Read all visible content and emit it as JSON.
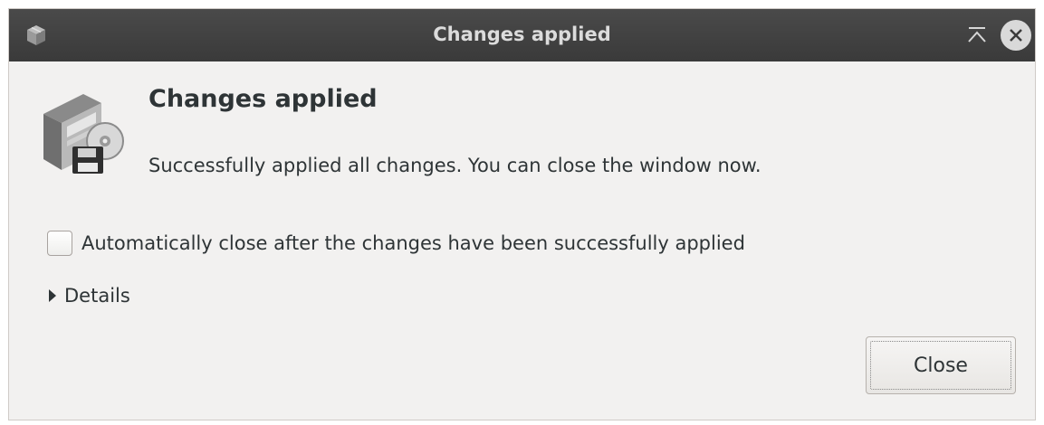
{
  "window": {
    "title": "Changes applied"
  },
  "titlebar": {
    "app_icon": "package-manager-icon",
    "maximize_icon": "maximize-icon",
    "close_icon": "close-icon"
  },
  "dialog": {
    "icon": "software-package-disk-icon",
    "heading": "Changes applied",
    "message": "Successfully applied all changes. You can close the window now.",
    "auto_close_checkbox": {
      "label": "Automatically close after the changes have been successfully applied",
      "checked": false
    },
    "details_expander": {
      "label": "Details",
      "expanded": false
    },
    "close_button_label": "Close"
  },
  "colors": {
    "titlebar_bg": "#3f3f3f",
    "window_bg": "#f2f1f0",
    "text": "#2e3436"
  }
}
